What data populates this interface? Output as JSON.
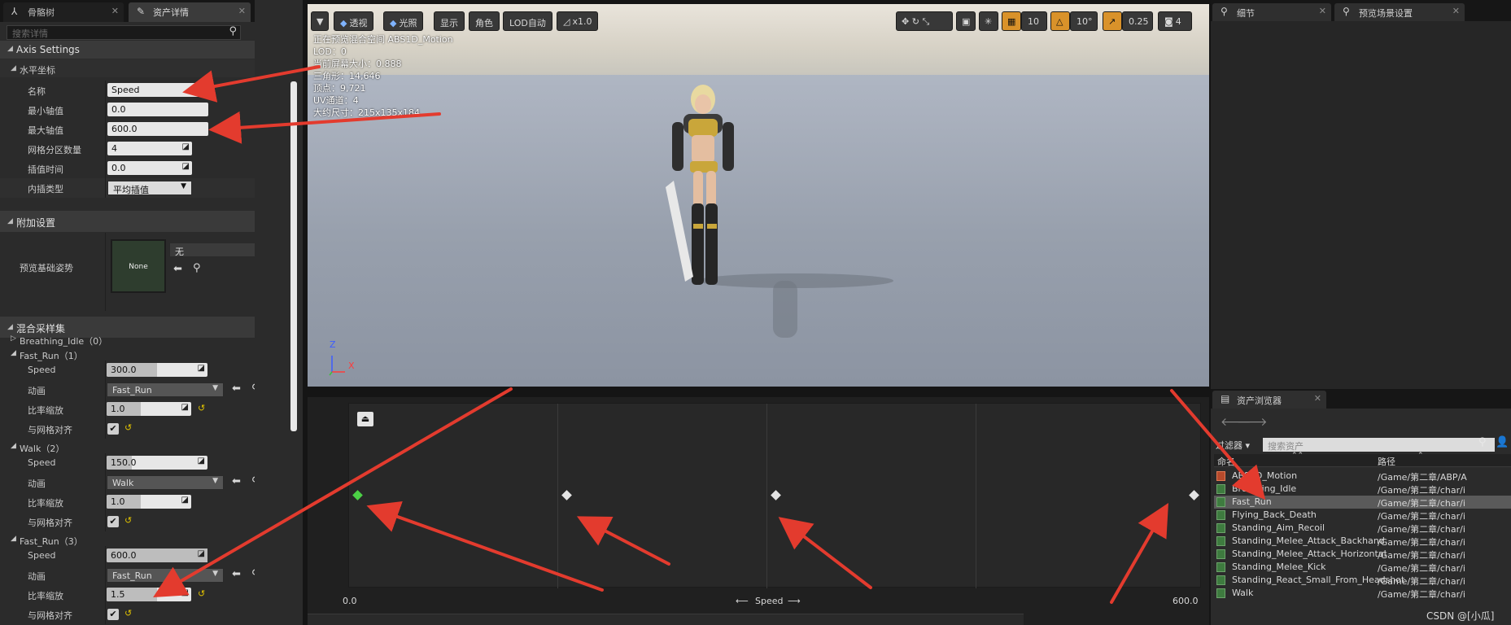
{
  "left_panel": {
    "tabs": [
      {
        "label": "骨骼树"
      },
      {
        "label": "资产详情"
      }
    ],
    "search_placeholder": "搜索详情",
    "axis_settings": {
      "title": "Axis Settings",
      "horizontal_title": "水平坐标",
      "rows": [
        {
          "label": "名称",
          "value": "Speed"
        },
        {
          "label": "最小轴值",
          "value": "0.0"
        },
        {
          "label": "最大轴值",
          "value": "600.0"
        },
        {
          "label": "网格分区数量",
          "value": "4"
        },
        {
          "label": "插值时间",
          "value": "0.0"
        },
        {
          "label": "内插类型",
          "value": "平均插值"
        }
      ]
    },
    "additional": {
      "title": "附加设置",
      "base_pose_label": "预览基础姿势",
      "thumb_text": "None",
      "dropdown_value": "无"
    },
    "samples": {
      "title": "混合采样集",
      "groups": [
        {
          "title": "Breathing_Idle（0）"
        },
        {
          "title": "Fast_Run（1）",
          "speed": "300.0",
          "anim": "Fast_Run",
          "rate": "1.0"
        },
        {
          "title": "Walk（2）",
          "speed": "150.0",
          "anim": "Walk",
          "rate": "1.0"
        },
        {
          "title": "Fast_Run（3）",
          "speed": "600.0",
          "anim": "Fast_Run",
          "rate": "1.5"
        }
      ],
      "labels": {
        "speed": "Speed",
        "anim": "动画",
        "rate": "比率缩放",
        "snap": "与网格对齐"
      }
    }
  },
  "viewport": {
    "toolbar": [
      {
        "label": "透视"
      },
      {
        "label": "光照"
      },
      {
        "label": "显示"
      },
      {
        "label": "角色"
      },
      {
        "label": "LOD自动"
      },
      {
        "label": "x1.0"
      }
    ],
    "right_toolbar": {
      "grid": "10",
      "angle": "10°",
      "scale": "0.25",
      "cam": "4"
    },
    "stats": [
      "正在预览混合空间 ABS1D_Motion",
      "LOD：0",
      "当前屏幕大小：0.888",
      "三角形：14,646",
      "顶点：9,721",
      "UV通道：4",
      "大约尺寸：215x135x184"
    ],
    "axis_z": "Z",
    "axis_x": "X"
  },
  "blend_graph": {
    "min_label": "0.0",
    "max_label": "600.0",
    "axis_label": "Speed",
    "points": [
      0,
      150,
      300,
      600
    ],
    "selected_index": 0
  },
  "right_panel": {
    "top_tabs": [
      {
        "label": "细节"
      },
      {
        "label": "预览场景设置"
      }
    ],
    "asset_browser": {
      "tab": "资产浏览器",
      "filter_label": "过滤器",
      "search_placeholder": "搜索资产",
      "col_name": "命名",
      "col_path": "路径",
      "assets": [
        {
          "name": "ABS1D_Motion",
          "path": "/Game/第二章/ABP/A",
          "type": "blendspace"
        },
        {
          "name": "Breathing_Idle",
          "path": "/Game/第二章/char/i",
          "type": "anim"
        },
        {
          "name": "Fast_Run",
          "path": "/Game/第二章/char/i",
          "type": "anim",
          "selected": true
        },
        {
          "name": "Flying_Back_Death",
          "path": "/Game/第二章/char/i",
          "type": "anim"
        },
        {
          "name": "Standing_Aim_Recoil",
          "path": "/Game/第二章/char/i",
          "type": "anim"
        },
        {
          "name": "Standing_Melee_Attack_Backhand",
          "path": "/Game/第二章/char/i",
          "type": "anim"
        },
        {
          "name": "Standing_Melee_Attack_Horizontal",
          "path": "/Game/第二章/char/i",
          "type": "anim"
        },
        {
          "name": "Standing_Melee_Kick",
          "path": "/Game/第二章/char/i",
          "type": "anim"
        },
        {
          "name": "Standing_React_Small_From_Headshot",
          "path": "/Game/第二章/char/i",
          "type": "anim"
        },
        {
          "name": "Walk",
          "path": "/Game/第二章/char/i",
          "type": "anim"
        }
      ]
    },
    "watermark": "CSDN @[小瓜]"
  },
  "colors": {
    "accent_orange": "#d9922a",
    "selected_point": "#4cd146",
    "arrow": "#e33b2e"
  }
}
